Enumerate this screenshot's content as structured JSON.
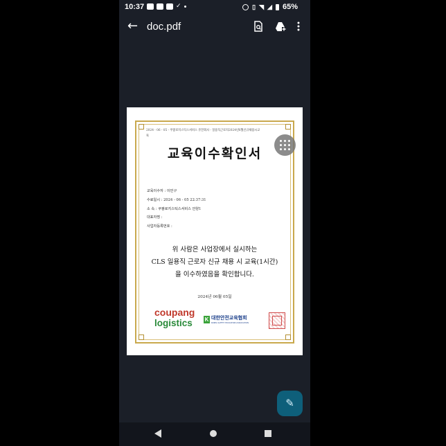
{
  "status_bar": {
    "time": "10:37",
    "battery": "65%",
    "left_icons": [
      "app-icon",
      "youtube-icon",
      "youtube-icon",
      "check-icon",
      "dot-icon"
    ],
    "right_icons": [
      "alarm-icon",
      "vibrate-icon",
      "wifi-icon",
      "signal-icon",
      "battery-icon"
    ]
  },
  "app_bar": {
    "title": "doc.pdf",
    "actions": [
      "search-page-icon",
      "drive-add-icon",
      "more-vert-icon"
    ]
  },
  "document": {
    "header_line": "2024 - 06 - 05 - 쿠팡로지스틱스서비스 유한회사 - 일용직근로자2024년6월신규채용시교",
    "header_line_2": "육",
    "title": "교육이수확인서",
    "fields": [
      "교육이수자 : 이민구",
      "수료일시 : 2024 - 06 - 05 22:37:31",
      "소      속 : 쿠팡로지스틱스서비스 안양1",
      "대표자명 :",
      "사업자등록번호 :"
    ],
    "body_lines": [
      "위 사람은 사업장에서 실시하는",
      "CLS 일용직 근로자 신규 채용 시 교육(1시간)",
      "을 이수하였음을 확인합니다."
    ],
    "issue_date": "2024년 06월 05일",
    "coupang_logo": {
      "line1": "coupang",
      "line2": "logistics"
    },
    "ksa_logo": {
      "mark": "K",
      "name": "대한안전교육협회",
      "sub": "KOREA SAFETY EDUCATION ASSOCIATION"
    }
  },
  "fab": {
    "edit_icon": "edit-pen-icon",
    "menu_icon": "grid-dots-icon"
  },
  "nav": [
    "back",
    "home",
    "recents"
  ],
  "colors": {
    "accent": "#0e5f7a",
    "frame": "#c9a84c",
    "coupang_red": "#c0392b",
    "coupang_green": "#2a8a3a"
  }
}
